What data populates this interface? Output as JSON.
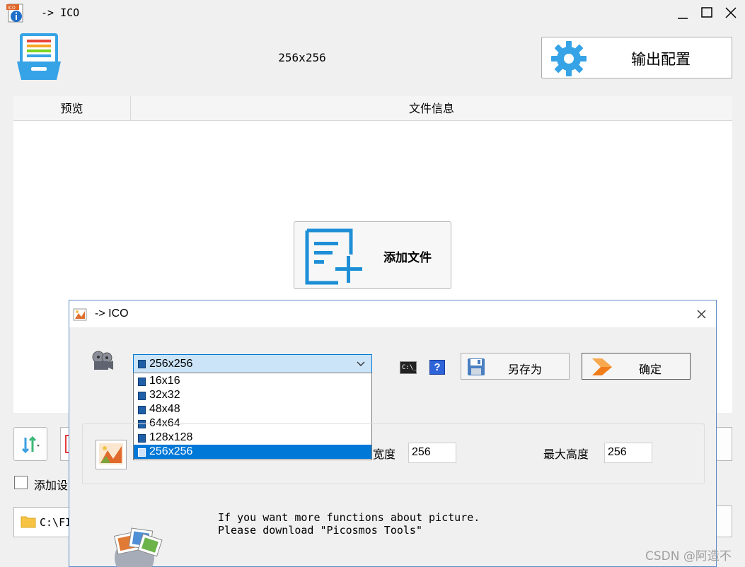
{
  "window": {
    "title": "-> ICO",
    "app_icon_badge": "ICO"
  },
  "header": {
    "size_label": "256x256",
    "output_config_label": "输出配置"
  },
  "file_table": {
    "columns": [
      "预览",
      "文件信息"
    ]
  },
  "add_file_label": "添加文件",
  "add_setting_checkbox_label": "添加设",
  "path_field_value": "C:\\FI",
  "dialog": {
    "title": "-> ICO",
    "size_select": {
      "value": "256x256",
      "options": [
        "16x16",
        "32x32",
        "48x48",
        "64x64",
        "128x128",
        "256x256"
      ],
      "selected_index": 5
    },
    "cmd_icon_text": "C:\\_",
    "help_icon_text": "?",
    "save_as_label": "另存为",
    "ok_label": "确定",
    "max_width_label": "宽度",
    "max_width_value": "256",
    "max_height_label": "最大高度",
    "max_height_value": "256",
    "promo_line1": "If you want more functions about picture.",
    "promo_line2": "Please download \"Picosmos Tools\""
  },
  "watermark": "CSDN @阿造不",
  "colors": {
    "accent_blue": "#0078d7",
    "gear_blue": "#36a3e6",
    "selection_bg": "#cce4f7"
  }
}
